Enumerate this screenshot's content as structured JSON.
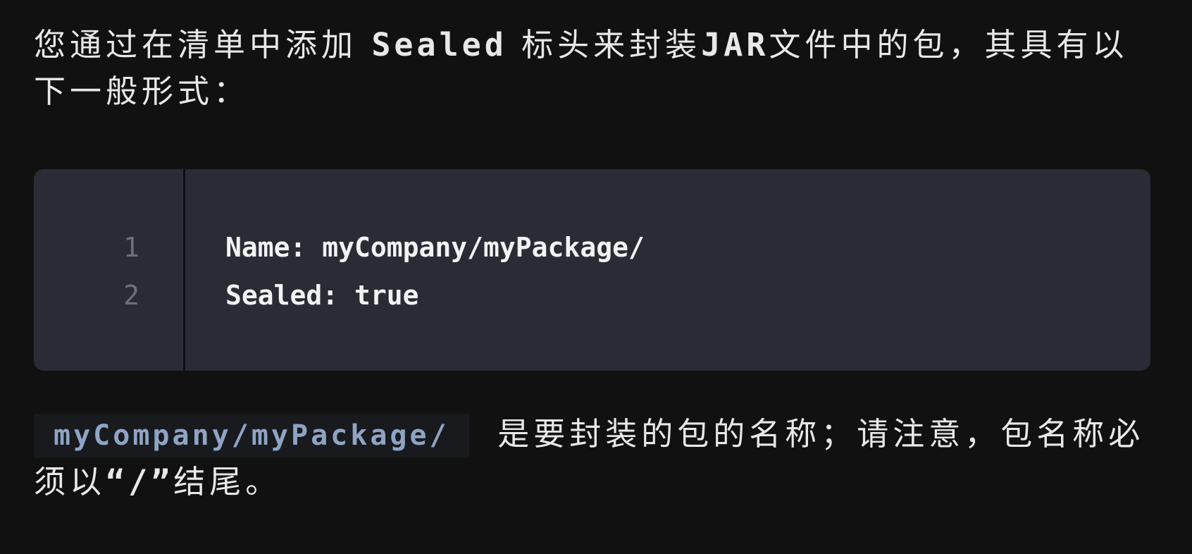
{
  "paragraph1": {
    "before": "您通过在清单中添加 ",
    "keyword": "Sealed",
    "middle": " 标头来封装",
    "jar": "JAR",
    "after": "文件中的包，其具有以下一般形式："
  },
  "code_block": {
    "line_numbers": [
      "1",
      "2"
    ],
    "lines": [
      "Name: myCompany/myPackage/",
      "Sealed: true"
    ]
  },
  "paragraph2": {
    "inline_code": "myCompany/myPackage/",
    "text": "  是要封装的包的名称；请注意，包名称必须以",
    "quote_open": "“",
    "slash": "/",
    "quote_close": "”",
    "end": "结尾。"
  }
}
